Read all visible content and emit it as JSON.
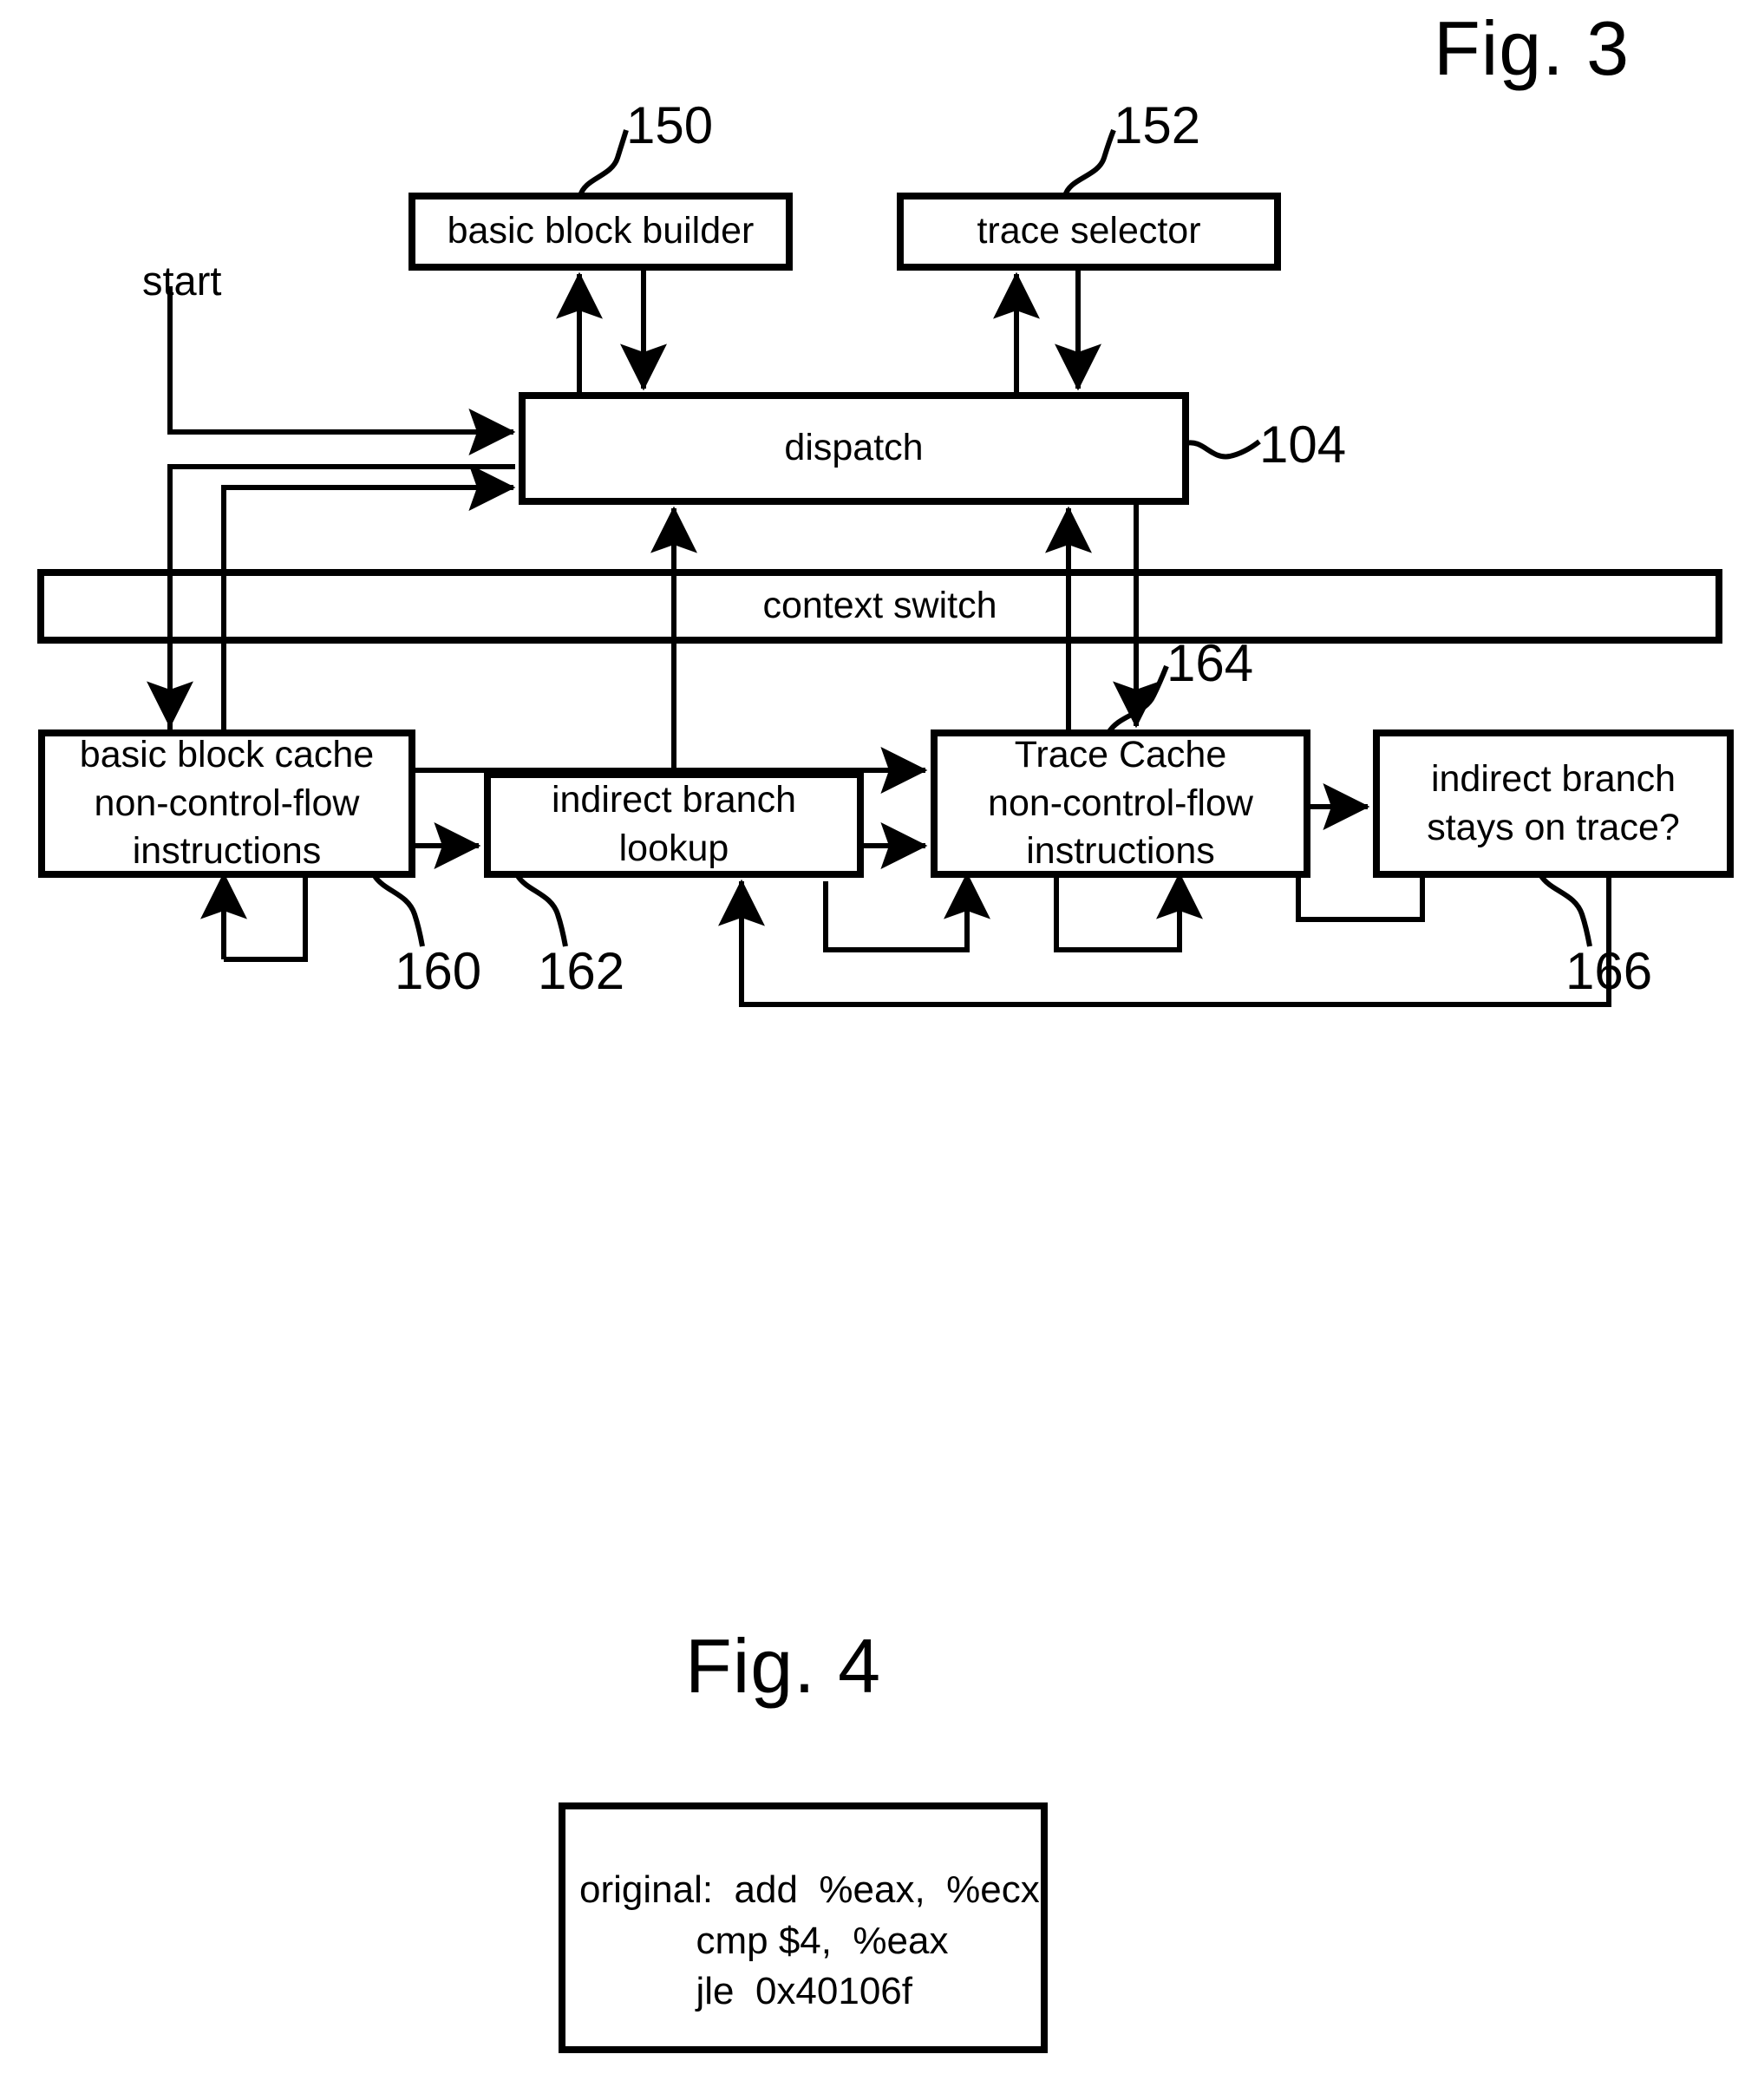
{
  "figures": [
    {
      "id": "fig3",
      "title": "Fig. 3"
    },
    {
      "id": "fig4",
      "title": "Fig. 4"
    }
  ],
  "fig3": {
    "title": "Fig. 3",
    "start_label": "start",
    "boxes": {
      "basic_block_builder": {
        "label": "basic block builder",
        "ref": "150"
      },
      "trace_selector": {
        "label": "trace selector",
        "ref": "152"
      },
      "dispatch": {
        "label": "dispatch",
        "ref": "104"
      },
      "context_switch": {
        "label": "context switch",
        "ref": ""
      },
      "basic_block_cache": {
        "label": "basic block cache\nnon-control-flow\ninstructions",
        "ref": "160"
      },
      "indirect_branch_lookup": {
        "label": "indirect branch\nlookup",
        "ref": "162"
      },
      "trace_cache": {
        "label": "Trace Cache\nnon-control-flow\ninstructions",
        "ref": "164"
      },
      "indirect_branch_stays": {
        "label": "indirect branch\nstays on trace?",
        "ref": "166"
      }
    },
    "reference_numerals": [
      "150",
      "152",
      "104",
      "160",
      "162",
      "164",
      "166"
    ]
  },
  "fig4": {
    "title": "Fig. 4",
    "code": {
      "label": "original:",
      "lines": [
        "add  %eax,  %ecx",
        "cmp $4,  %eax",
        "jle  0x40106f"
      ],
      "full_text": "original:  add  %eax,  %ecx\n           cmp $4,  %eax\n           jle  0x40106f"
    }
  },
  "colors": {
    "stroke": "#000000",
    "background": "#ffffff",
    "text": "#000000"
  }
}
